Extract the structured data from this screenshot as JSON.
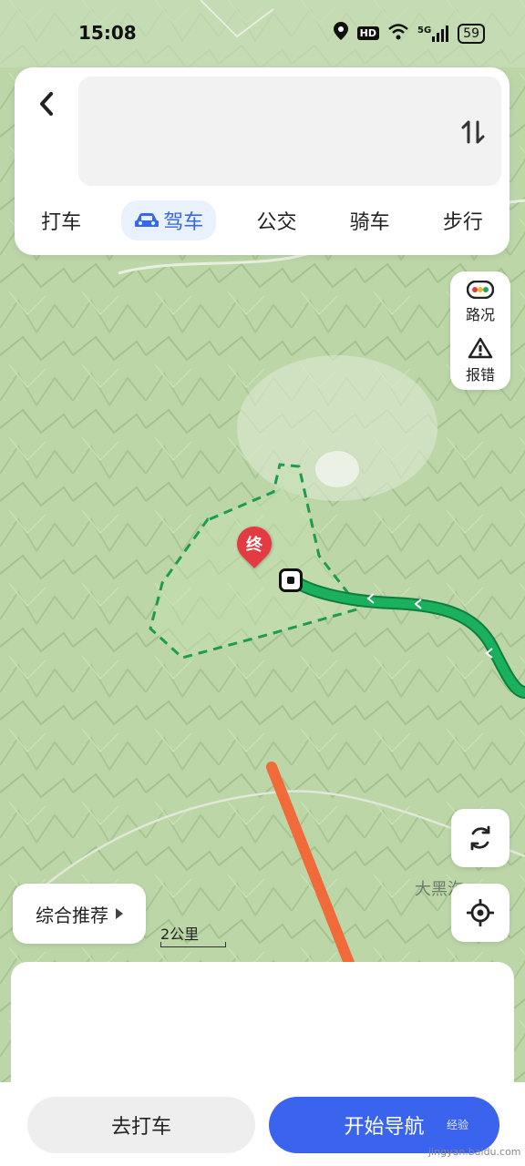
{
  "status_bar": {
    "time": "15:08",
    "hd_label": "HD",
    "network_label": "5G",
    "battery": "59"
  },
  "header": {
    "back_icon": "chevron-left-icon",
    "swap_icon": "swap-vertical-icon",
    "mode_tabs": [
      {
        "label": "打车"
      },
      {
        "label": "驾车",
        "active": true
      },
      {
        "label": "公交"
      },
      {
        "label": "骑车"
      },
      {
        "label": "步行"
      }
    ]
  },
  "map": {
    "destination_marker": "终",
    "place_label": "大黑沟",
    "scale_label": "2公里",
    "route_color": "#1aa35a"
  },
  "side_tools": {
    "traffic_label": "路况",
    "report_label": "报错"
  },
  "recommend": {
    "label": "综合推荐"
  },
  "actions": {
    "taxi_label": "去打车",
    "navigate_label": "开始导航"
  },
  "watermark": {
    "text": "经验",
    "host": "jingyan.baidu.com"
  }
}
